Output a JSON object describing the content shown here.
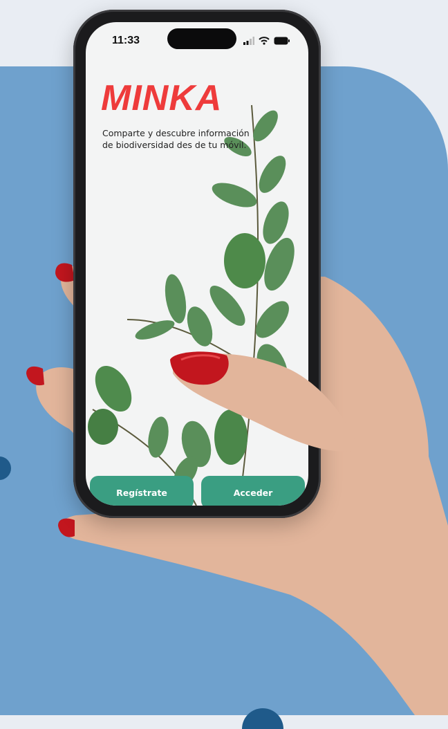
{
  "status_bar": {
    "time": "11:33",
    "icons": [
      "signal-icon",
      "wifi-icon",
      "battery-icon"
    ]
  },
  "app": {
    "logo_text": "MINKA",
    "tagline": "Comparte y descubre información de biodiversidad des de tu móvil."
  },
  "actions": {
    "register_label": "Regístrate",
    "login_label": "Acceder"
  },
  "colors": {
    "brand_red": "#ee3b3b",
    "button_green": "#3a9e82",
    "background_blue": "#6fa1cd",
    "dot_blue": "#1f5a8a"
  }
}
